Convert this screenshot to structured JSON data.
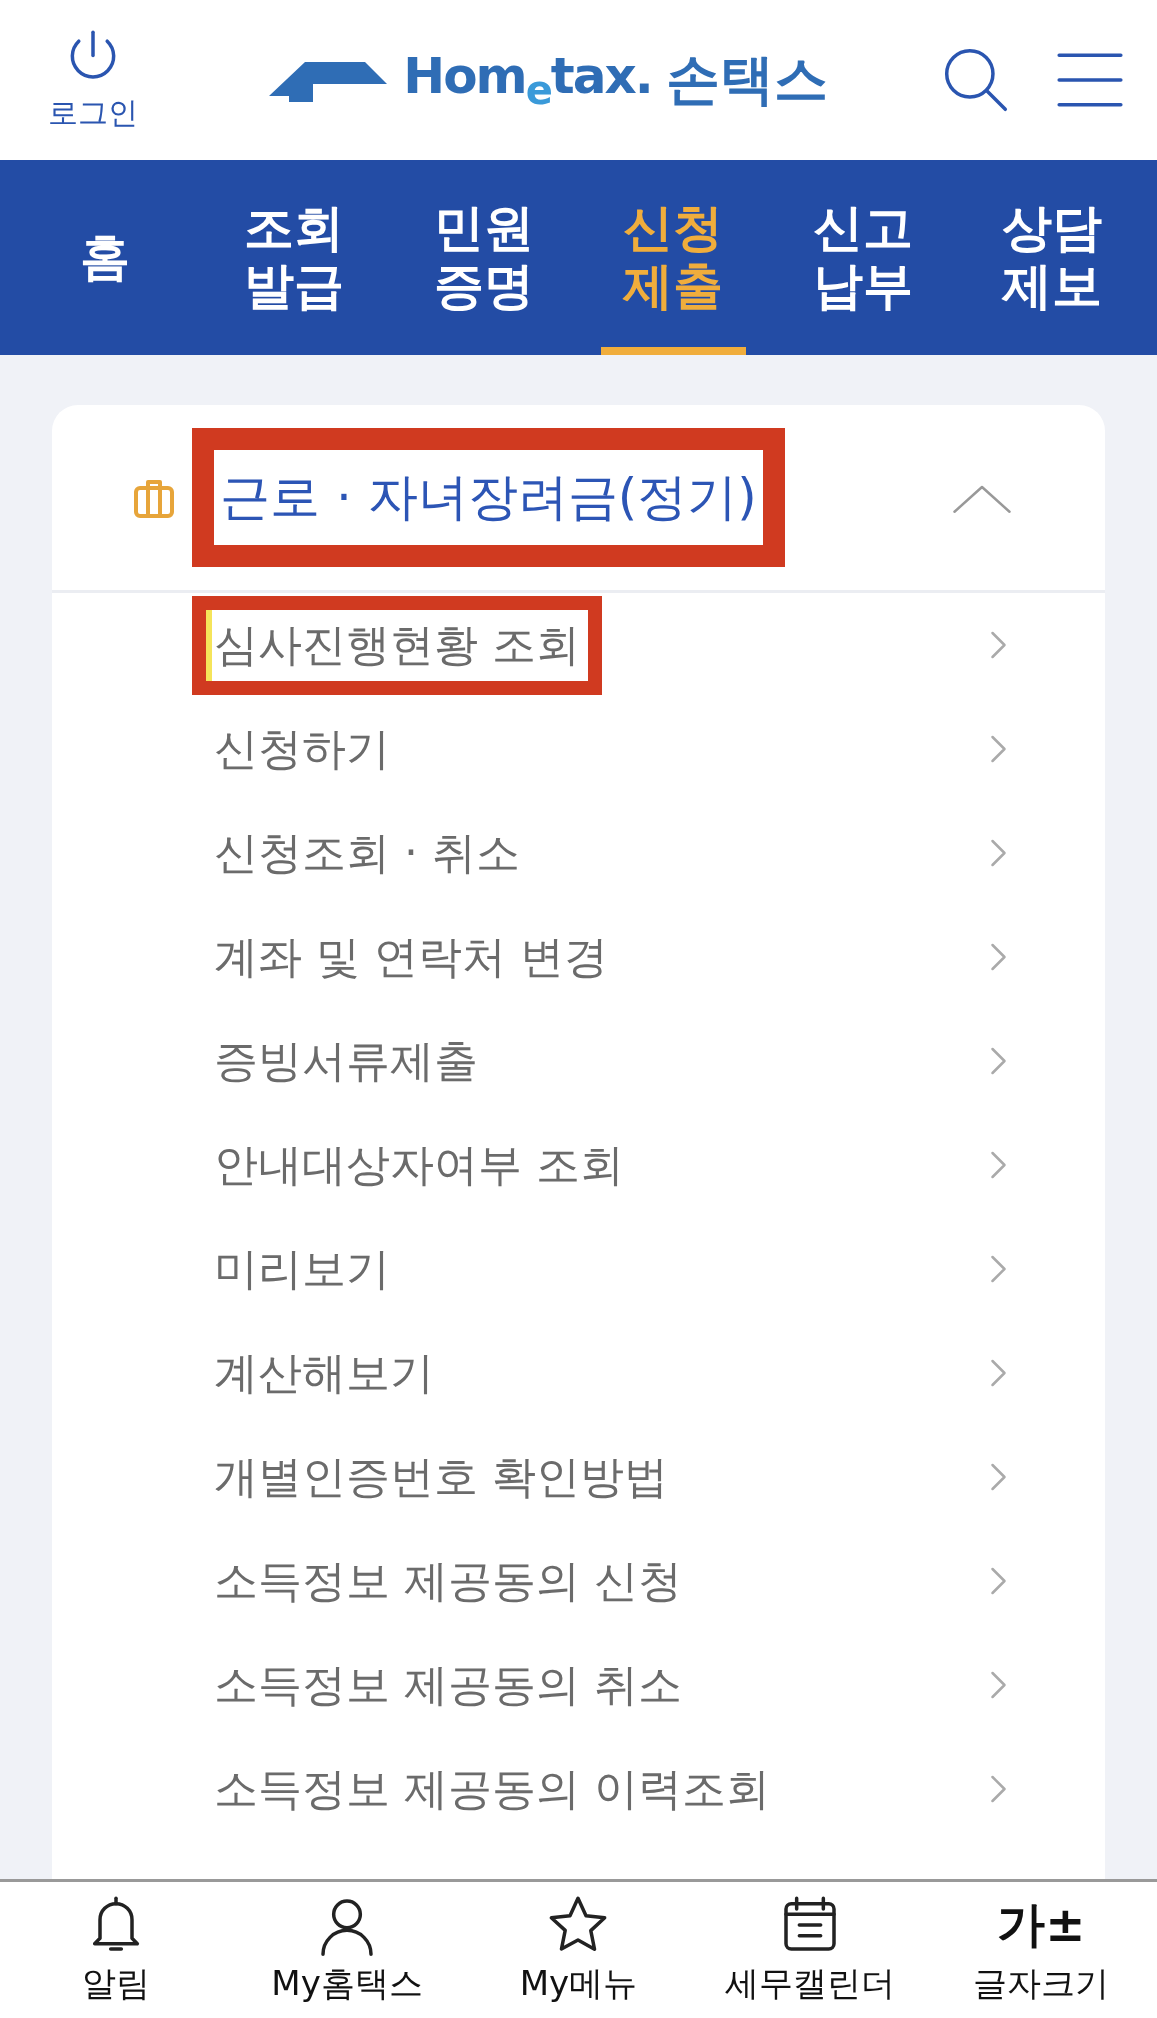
{
  "header": {
    "login_label": "로그인",
    "logo_text": "Hom$_{e}$tax.",
    "logo_subtitle": "손택스"
  },
  "nav_tabs": [
    {
      "label": "홈",
      "selected": false
    },
    {
      "label": "조회\n발급",
      "selected": false
    },
    {
      "label": "민원\n증명",
      "selected": false
    },
    {
      "label": "신청\n제출",
      "selected": true
    },
    {
      "label": "신고\n납부",
      "selected": false
    },
    {
      "label": "상담\n제보",
      "selected": false
    }
  ],
  "section": {
    "title": "근로 · 자녀장려금(정기)",
    "expanded": true,
    "highlighted": true,
    "items": [
      {
        "label": "심사진행현황 조회",
        "selected": true,
        "highlighted": true
      },
      {
        "label": "신청하기",
        "selected": false,
        "highlighted": false
      },
      {
        "label": "신청조회 · 취소",
        "selected": false,
        "highlighted": false
      },
      {
        "label": "계좌 및 연락처 변경",
        "selected": false,
        "highlighted": false
      },
      {
        "label": "증빙서류제출",
        "selected": false,
        "highlighted": false
      },
      {
        "label": "안내대상자여부 조회",
        "selected": false,
        "highlighted": false
      },
      {
        "label": "미리보기",
        "selected": false,
        "highlighted": false
      },
      {
        "label": "계산해보기",
        "selected": false,
        "highlighted": false
      },
      {
        "label": "개별인증번호 확인방법",
        "selected": false,
        "highlighted": false
      },
      {
        "label": "소득정보 제공동의 신청",
        "selected": false,
        "highlighted": false
      },
      {
        "label": "소득정보 제공동의 취소",
        "selected": false,
        "highlighted": false
      },
      {
        "label": "소득정보 제공동의 이력조회",
        "selected": false,
        "highlighted": false
      }
    ]
  },
  "bottom_bar": [
    {
      "kind": "bell",
      "label": "알림"
    },
    {
      "kind": "person",
      "label": "My홈택스"
    },
    {
      "kind": "star",
      "label": "My메뉴"
    },
    {
      "kind": "calendar",
      "label": "세무캘린더"
    },
    {
      "kind": "text",
      "icon_text": "가±",
      "label": "글자크기"
    }
  ]
}
